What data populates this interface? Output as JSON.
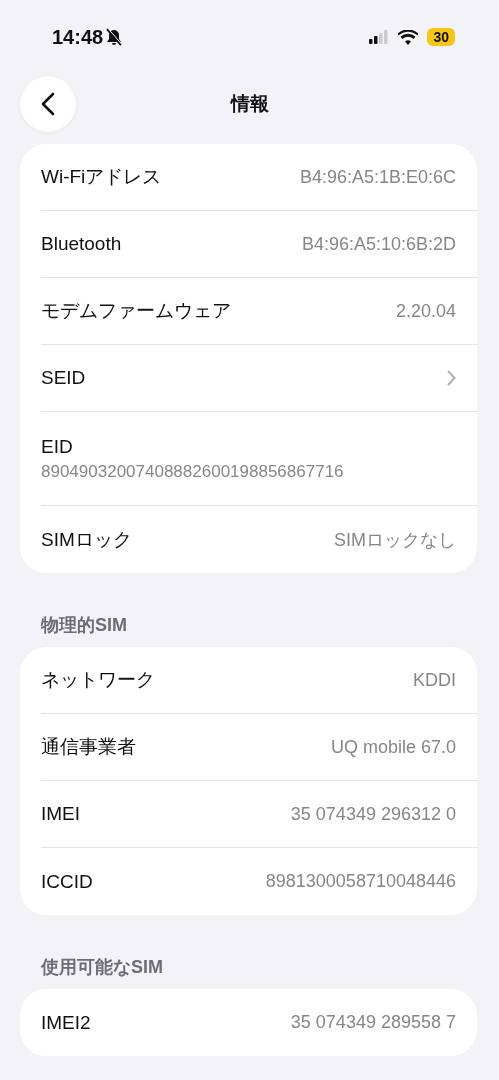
{
  "status_bar": {
    "time": "14:48",
    "silent": true,
    "battery": "30"
  },
  "nav": {
    "title": "情報"
  },
  "sections": [
    {
      "rows": [
        {
          "kind": "value",
          "label": "Wi-Fiアドレス",
          "value": "B4:96:A5:1B:E0:6C"
        },
        {
          "kind": "value",
          "label": "Bluetooth",
          "value": "B4:96:A5:10:6B:2D"
        },
        {
          "kind": "value",
          "label": "モデムファームウェア",
          "value": "2.20.04"
        },
        {
          "kind": "chevron",
          "label": "SEID"
        },
        {
          "kind": "stacked",
          "label": "EID",
          "value": "89049032007408882600198856867716"
        },
        {
          "kind": "value",
          "label": "SIMロック",
          "value": "SIMロックなし"
        }
      ]
    },
    {
      "header": "物理的SIM",
      "rows": [
        {
          "kind": "value",
          "label": "ネットワーク",
          "value": "KDDI"
        },
        {
          "kind": "value",
          "label": "通信事業者",
          "value": "UQ mobile 67.0"
        },
        {
          "kind": "value",
          "label": "IMEI",
          "value": "35 074349 296312 0"
        },
        {
          "kind": "value",
          "label": "ICCID",
          "value": "8981300058710048446"
        }
      ]
    },
    {
      "header": "使用可能なSIM",
      "rows": [
        {
          "kind": "value",
          "label": "IMEI2",
          "value": "35 074349 289558 7"
        }
      ]
    }
  ]
}
